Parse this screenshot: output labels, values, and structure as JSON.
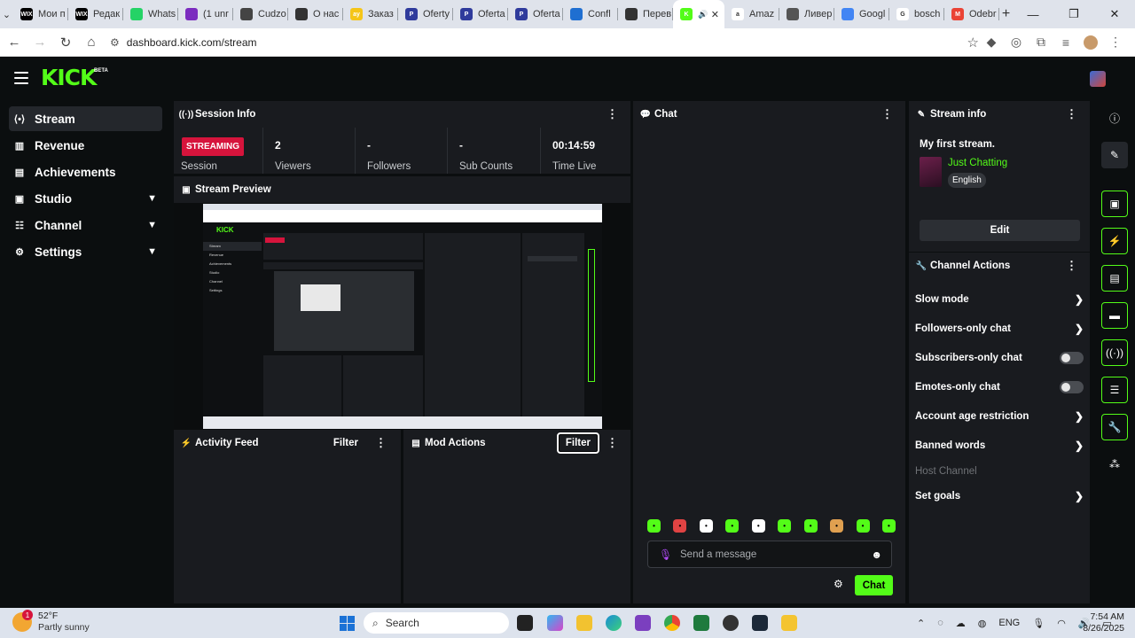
{
  "browser": {
    "tabs": [
      {
        "label": "Мои п",
        "fav": "WIX",
        "color": "#000000"
      },
      {
        "label": "Редак",
        "fav": "WIX",
        "color": "#000000"
      },
      {
        "label": "Whats",
        "fav": "",
        "color": "#25d366"
      },
      {
        "label": "(1 unr",
        "fav": "",
        "color": "#7b2cbf"
      },
      {
        "label": "Cudzo",
        "fav": "",
        "color": "#444444"
      },
      {
        "label": "О нас",
        "fav": "",
        "color": "#333333"
      },
      {
        "label": "Заказ",
        "fav": "ay",
        "color": "#f5c518"
      },
      {
        "label": "Oferty",
        "fav": "P",
        "color": "#2f3b9c"
      },
      {
        "label": "Oferta",
        "fav": "P",
        "color": "#2f3b9c"
      },
      {
        "label": "Oferta",
        "fav": "P",
        "color": "#2f3b9c"
      },
      {
        "label": "Confl",
        "fav": "",
        "color": "#1f6fd1"
      },
      {
        "label": "Перев",
        "fav": "",
        "color": "#333333"
      },
      {
        "label": "",
        "fav": "K",
        "color": "#53fc18",
        "active": true
      },
      {
        "label": "Amaz",
        "fav": "a",
        "color": "#ffffff"
      },
      {
        "label": "Ливер",
        "fav": "",
        "color": "#555555"
      },
      {
        "label": "Googl",
        "fav": "",
        "color": "#4285f4"
      },
      {
        "label": "bosch",
        "fav": "G",
        "color": "#ffffff"
      },
      {
        "label": "Odebr",
        "fav": "M",
        "color": "#ea4335"
      }
    ],
    "url": "dashboard.kick.com/stream"
  },
  "app": {
    "beta": "BETA"
  },
  "sidebar": {
    "items": [
      {
        "label": "Stream",
        "icon": "stream-icon"
      },
      {
        "label": "Revenue",
        "icon": "revenue-icon"
      },
      {
        "label": "Achievements",
        "icon": "achievements-icon"
      },
      {
        "label": "Studio",
        "icon": "studio-icon"
      },
      {
        "label": "Channel",
        "icon": "channel-icon"
      },
      {
        "label": "Settings",
        "icon": "settings-icon"
      }
    ]
  },
  "session": {
    "title": "Session Info",
    "status": "STREAMING",
    "stats": [
      {
        "value": "",
        "label": "Session"
      },
      {
        "value": "2",
        "label": "Viewers"
      },
      {
        "value": "-",
        "label": "Followers"
      },
      {
        "value": "-",
        "label": "Sub Counts"
      },
      {
        "value": "00:14:59",
        "label": "Time Live"
      }
    ]
  },
  "preview": {
    "title": "Stream Preview"
  },
  "activity": {
    "title": "Activity Feed",
    "filter": "Filter"
  },
  "mod": {
    "title": "Mod Actions",
    "filter": "Filter"
  },
  "chat": {
    "title": "Chat",
    "placeholder": "Send a message",
    "send": "Chat",
    "emote_colors": [
      "#53fc18",
      "#e04343",
      "#ffffff",
      "#53fc18",
      "#ffffff",
      "#53fc18",
      "#53fc18",
      "#e0a050",
      "#53fc18",
      "#53fc18"
    ]
  },
  "stream_info": {
    "title": "Stream info",
    "stream_title": "My first stream.",
    "category": "Just Chatting",
    "language": "English",
    "edit": "Edit"
  },
  "channel_actions": {
    "title": "Channel Actions",
    "items": [
      {
        "label": "Slow mode",
        "control": "chevron"
      },
      {
        "label": "Followers-only chat",
        "control": "chevron"
      },
      {
        "label": "Subscribers-only chat",
        "control": "toggle",
        "on": false
      },
      {
        "label": "Emotes-only chat",
        "control": "toggle",
        "on": false
      },
      {
        "label": "Account age restriction",
        "control": "chevron"
      },
      {
        "label": "Banned words",
        "control": "chevron"
      },
      {
        "label": "Host Channel",
        "control": "none",
        "disabled": true
      },
      {
        "label": "Set goals",
        "control": "chevron"
      }
    ]
  },
  "taskbar": {
    "temp": "52°F",
    "weather": "Partly sunny",
    "weather_badge": "1",
    "search": "Search",
    "lang": "ENG",
    "time": "7:54 AM",
    "date": "8/26/2025"
  },
  "colors": {
    "accent": "#53fc18",
    "live": "#d6143c",
    "panel": "#191b1f",
    "background": "#0b0e0f"
  }
}
